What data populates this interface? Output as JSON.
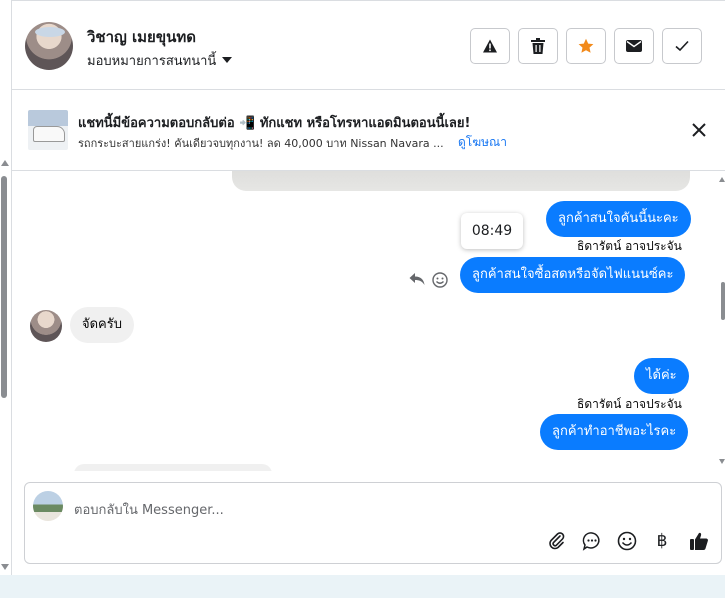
{
  "header": {
    "contact_name": "วิชาญ เมยขุนทด",
    "assign_label": "มอบหมายการสนทนานี้",
    "actions": [
      "spam",
      "delete",
      "star",
      "mark-unread",
      "mark-done"
    ]
  },
  "ad": {
    "title": "แชทนี้มีข้อความตอบกลับต่อ 📲 ทักแชท หรือโทรหาแอดมินตอนนี้เลย!",
    "subtitle": "รถกระบะสายแกร่ง! คันเดียวจบทุกงาน! ลด 40,000 บาท Nissan Navara ...",
    "link": "ดูโฆษณา"
  },
  "messages": [
    {
      "side": "out",
      "text": "ลูกค้าสนใจคันนี้นะคะ"
    },
    {
      "side": "out",
      "sender": "ธิดารัตน์ อาจประจัน",
      "text": "ลูกค้าสนใจซื้อสดหรือจัดไฟแนนซ์คะ",
      "time": "08:49"
    },
    {
      "side": "in",
      "text": "จัดครับ"
    },
    {
      "side": "out",
      "text": "ได้ค่ะ"
    },
    {
      "side": "out",
      "sender": "ธิดารัตน์ อาจประจัน",
      "text": "ลูกค้าทำอาชีพอะไรคะ"
    }
  ],
  "composer": {
    "placeholder": "ตอบกลับใน Messenger...",
    "tools": [
      "attach",
      "saved-reply",
      "emoji",
      "baht",
      "like"
    ],
    "baht_symbol": "฿"
  },
  "colors": {
    "outgoing_bubble": "#0a7cff",
    "incoming_bubble": "#f0f0f0",
    "link": "#1877f2",
    "star": "#f28a1b"
  }
}
